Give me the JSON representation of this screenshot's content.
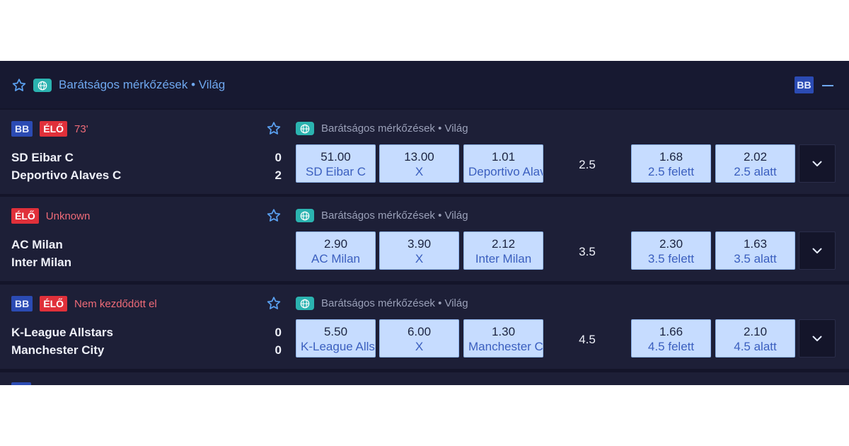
{
  "header": {
    "league": "Barátságos mérkőzések • Világ",
    "bb_label": "BB"
  },
  "matches": [
    {
      "bb_label": "BB",
      "live_label": "ÉLŐ",
      "status": "73'",
      "league": "Barátságos mérkőzések • Világ",
      "home": "SD Eibar C",
      "away": "Deportivo Alaves C",
      "home_score": "0",
      "away_score": "2",
      "odds_1x2": [
        {
          "value": "51.00",
          "label": "SD Eibar C"
        },
        {
          "value": "13.00",
          "label": "X"
        },
        {
          "value": "1.01",
          "label": "Deportivo Alaves C"
        }
      ],
      "total_line": "2.5",
      "odds_total": [
        {
          "value": "1.68",
          "label": "2.5 felett"
        },
        {
          "value": "2.02",
          "label": "2.5 alatt"
        }
      ]
    },
    {
      "bb_label": "",
      "live_label": "ÉLŐ",
      "status": "Unknown",
      "league": "Barátságos mérkőzések • Világ",
      "home": "AC Milan",
      "away": "Inter Milan",
      "home_score": "",
      "away_score": "",
      "odds_1x2": [
        {
          "value": "2.90",
          "label": "AC Milan"
        },
        {
          "value": "3.90",
          "label": "X"
        },
        {
          "value": "2.12",
          "label": "Inter Milan"
        }
      ],
      "total_line": "3.5",
      "odds_total": [
        {
          "value": "2.30",
          "label": "3.5 felett"
        },
        {
          "value": "1.63",
          "label": "3.5 alatt"
        }
      ]
    },
    {
      "bb_label": "BB",
      "live_label": "ÉLŐ",
      "status": "Nem kezdődött el",
      "league": "Barátságos mérkőzések • Világ",
      "home": "K-League Allstars",
      "away": "Manchester City",
      "home_score": "0",
      "away_score": "0",
      "odds_1x2": [
        {
          "value": "5.50",
          "label": "K-League Allstars"
        },
        {
          "value": "6.00",
          "label": "X"
        },
        {
          "value": "1.30",
          "label": "Manchester City"
        }
      ],
      "total_line": "4.5",
      "odds_total": [
        {
          "value": "1.66",
          "label": "4.5 felett"
        },
        {
          "value": "2.10",
          "label": "4.5 alatt"
        }
      ]
    }
  ],
  "colors": {
    "accent": "#6fa8f0",
    "live": "#e0303a",
    "odd_bg": "#c6dcff"
  },
  "icons": {
    "favorite": "star-icon",
    "league": "globe-icon",
    "collapse": "minus-icon",
    "expand": "chevron-down-icon"
  }
}
